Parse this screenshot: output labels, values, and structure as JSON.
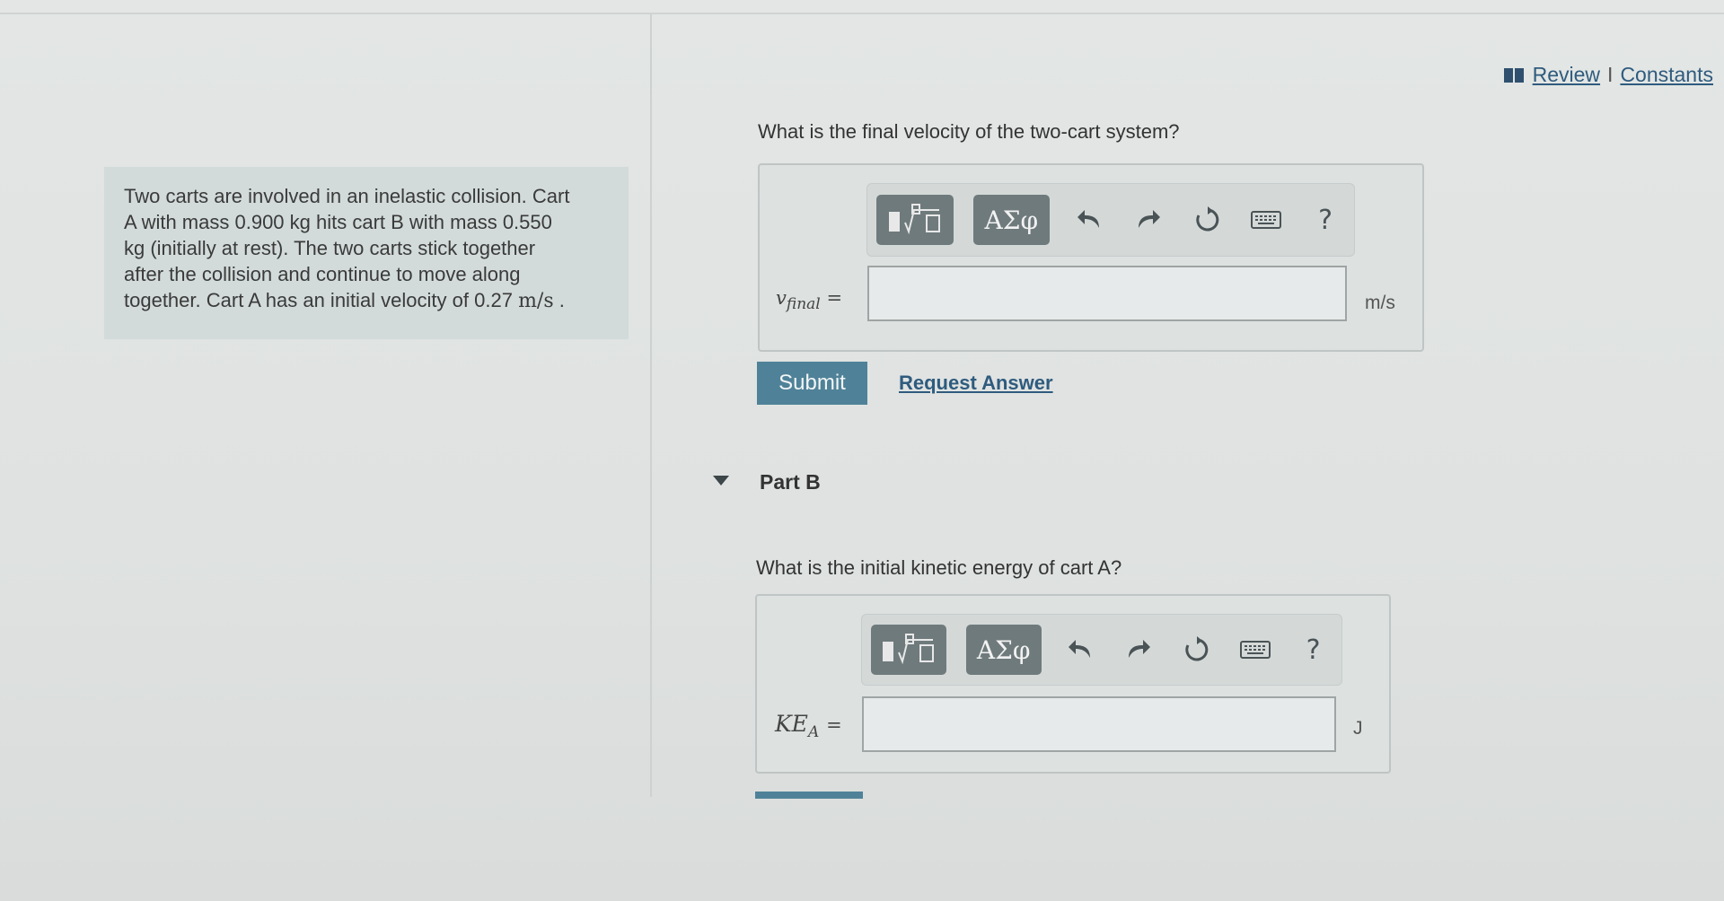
{
  "header": {
    "review_label": "Review",
    "separator": "I",
    "constants_label": "Constants"
  },
  "problem": {
    "line1": "Two carts are involved in an inelastic collision.  Cart",
    "line2": "A with mass 0.900 kg hits cart B with mass 0.550",
    "line3": "kg (initially at rest).  The two carts stick together",
    "line4": "after the collision and continue to move along",
    "line5_prefix": "together. Cart A has an initial velocity of 0.27",
    "line5_unit": "m/s",
    "line5_suffix": " ."
  },
  "part_a": {
    "question": "What is the final velocity of the two-cart system?",
    "var_symbol": "v",
    "var_subscript": "final",
    "equals": "=",
    "input_value": "",
    "unit": "m/s",
    "toolbar": {
      "greek_label": "ΑΣφ",
      "help_label": "?"
    },
    "submit_label": "Submit",
    "request_answer_label": "Request Answer"
  },
  "part_b": {
    "title": "Part B",
    "question": "What is the initial kinetic energy of cart A?",
    "var_symbol": "KE",
    "var_subscript": "A",
    "equals": "=",
    "input_value": "",
    "unit": "J",
    "toolbar": {
      "greek_label": "ΑΣφ",
      "help_label": "?"
    }
  },
  "icons": [
    "book-icon",
    "template-icon",
    "undo-icon",
    "redo-icon",
    "reset-icon",
    "keyboard-icon",
    "help-icon",
    "collapse-triangle-icon"
  ],
  "colors": {
    "accent": "#4f8298",
    "link": "#2f5b7e",
    "toolbar_button": "#6f7a7c",
    "problem_bg": "#d2dbda"
  }
}
